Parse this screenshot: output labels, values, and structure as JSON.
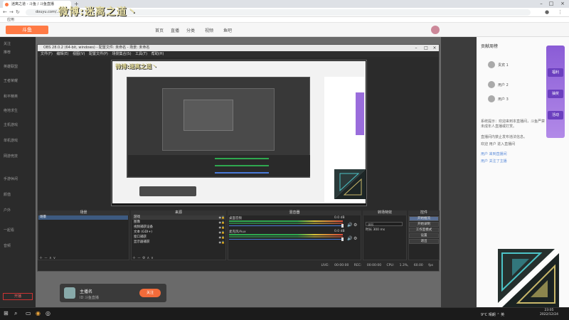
{
  "browser": {
    "tab_title": "迷离之道 - 斗鱼 / 斗鱼直播",
    "new_tab": "+",
    "address": "douyu.com/…",
    "bookmarks_label": "应用",
    "window_controls": {
      "minimize": "–",
      "maximize": "□",
      "close": "×"
    }
  },
  "overlay": {
    "title": "微博:迷离之道丶"
  },
  "site": {
    "logo": "斗鱼",
    "nav": [
      "首页",
      "直播",
      "分类",
      "视频",
      "鱼吧"
    ],
    "sidebar": {
      "items": [
        "关注",
        "推荐",
        "英雄联盟",
        "王者荣耀",
        "和平精英",
        "绝地求生",
        "主机游戏",
        "单机游戏",
        "网游竞技",
        "手游休闲",
        "颜值",
        "户外",
        "一起看",
        "音频"
      ],
      "bottom_button": "开播"
    },
    "streamer": {
      "name": "主播名",
      "sub": "ID 斗鱼直播",
      "follow": "关注"
    },
    "chat": {
      "title": "贡献周榜",
      "ranks": [
        "贵宾 1",
        "用户 2",
        "用户 3"
      ],
      "lines": [
        "系统提示：欢迎来到本直播间，斗鱼严禁未成年人直播或打赏。",
        "直播间内禁止发布违法信息。",
        "欢迎 用户 进入直播间"
      ],
      "highlight_lines": [
        "用户 来到直播间",
        "用户 关注了主播"
      ],
      "purple_badges": [
        "福利",
        "抽奖",
        "活动"
      ]
    }
  },
  "obs": {
    "title": "OBS 28.0.2 (64-bit, windows) - 配置文件: 未命名 - 场景: 未命名",
    "menu": [
      "文件(F)",
      "编辑(E)",
      "视图(V)",
      "配置文件(P)",
      "场景集合(S)",
      "工具(T)",
      "帮助(H)"
    ],
    "docks": {
      "scenes": "场景",
      "sources": "来源",
      "mixer": "混音器",
      "transitions": "转场特效",
      "controls": "控件"
    },
    "scenes": [
      "场景"
    ],
    "sources": [
      "游戏",
      "图像",
      "视频捕获设备",
      "文本 (GDI+)",
      "窗口捕获",
      "显示器捕获"
    ],
    "mixer": [
      {
        "name": "桌面音频",
        "value": "0.0 dB"
      },
      {
        "name": "麦克风/Aux",
        "value": "0.0 dB"
      }
    ],
    "transition": {
      "type": "淡出",
      "duration_label": "时长",
      "duration": "300 ms"
    },
    "controls": [
      "开始推流",
      "开始录制",
      "工作室模式",
      "设置",
      "退出"
    ],
    "status": "LIVE: 00:00:00   REC: 00:00:00   CPU: 1.3%, 60.00 fps"
  },
  "taskbar": {
    "start": "⊞",
    "search": "⌕",
    "tray": "9°C 晴朗  ⌃  英",
    "time": "23:05",
    "date": "2022/12/24"
  }
}
